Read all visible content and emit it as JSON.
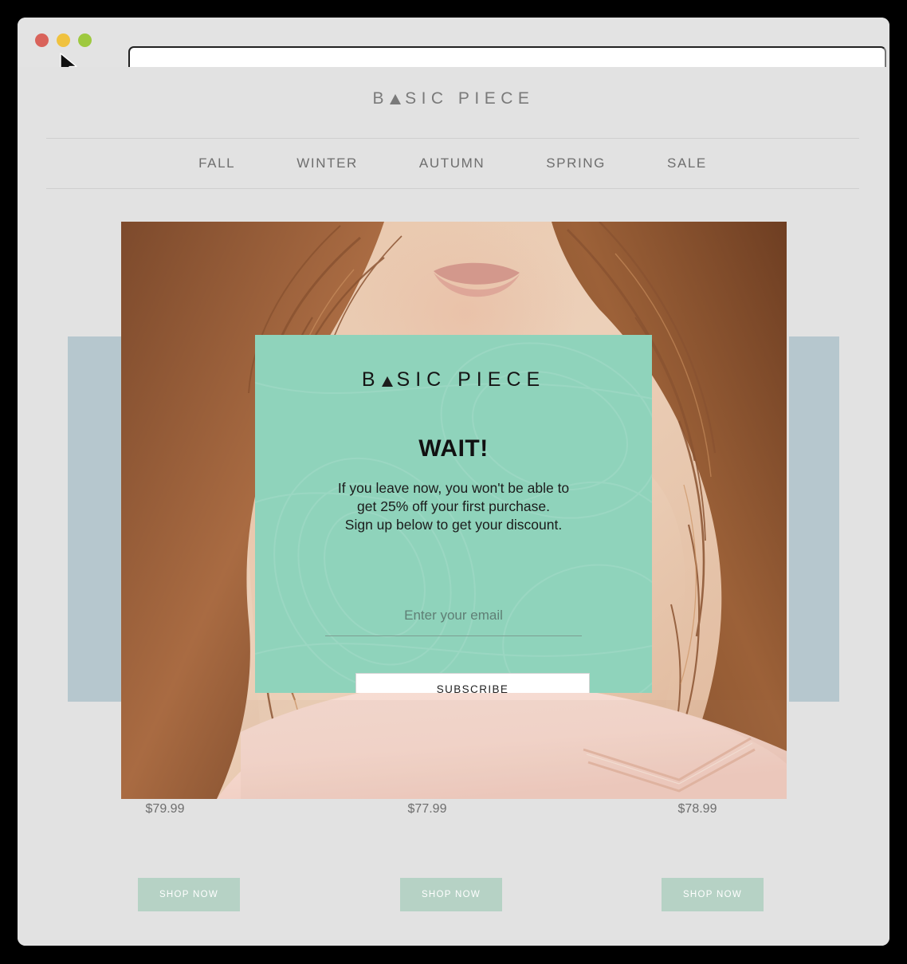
{
  "browser": {
    "traffic_lights": [
      {
        "name": "close",
        "color": "#d9635b"
      },
      {
        "name": "minimize",
        "color": "#f0c23f"
      },
      {
        "name": "maximize",
        "color": "#9ec93f"
      }
    ],
    "url_value": "",
    "url_placeholder": ""
  },
  "site": {
    "logo": {
      "before": "B",
      "after": "SIC PIECE"
    },
    "nav": [
      {
        "label": "FALL"
      },
      {
        "label": "WINTER"
      },
      {
        "label": "AUTUMN"
      },
      {
        "label": "SPRING"
      },
      {
        "label": "SALE"
      }
    ],
    "products": [
      {
        "price": "$79.99",
        "cta": "SHOP NOW"
      },
      {
        "price": "$77.99",
        "cta": "SHOP NOW"
      },
      {
        "price": "$78.99",
        "cta": "SHOP NOW"
      }
    ]
  },
  "modal": {
    "logo": {
      "before": "B",
      "after": "SIC PIECE"
    },
    "heading": "WAIT!",
    "body_line_1": "If you leave now, you won't be able to",
    "body_line_2": "get 25% off your first purchase.",
    "body_line_3": "Sign up below to get your discount.",
    "email_placeholder": "Enter your email",
    "email_value": "",
    "subscribe_label": "SUBSCRIBE",
    "background_color": "#8fd3bb"
  },
  "theme": {
    "page_background": "#e2e2e2",
    "accent_mint": "#8fd3bb",
    "panel_blue": "#b6c7ce",
    "button_mint": "#b6d2c5"
  }
}
